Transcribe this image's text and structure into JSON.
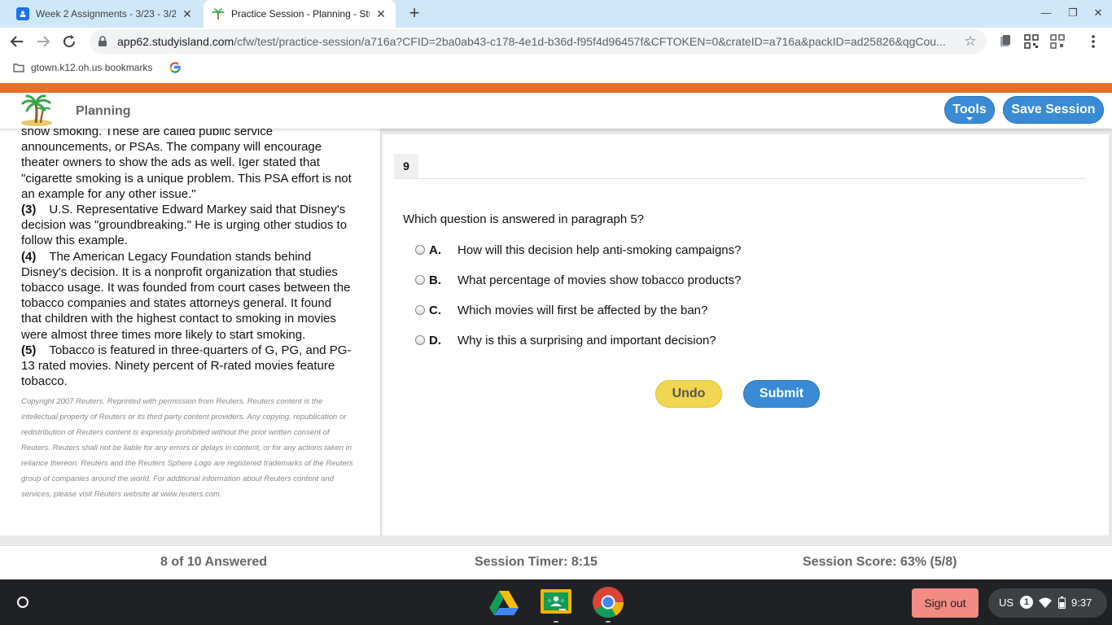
{
  "browser": {
    "tabs": [
      {
        "title": "Week 2 Assignments - 3/23 - 3/2",
        "icon": "classroom-favicon-icon"
      },
      {
        "title": "Practice Session - Planning - Stu",
        "icon": "studyisland-favicon-icon"
      }
    ],
    "url_host": "app62.studyisland.com",
    "url_path": "/cfw/test/practice-session/a716a?CFID=2ba0ab43-c178-4e1d-b36d-f95f4d96457f&CFTOKEN=0&crateID=a716a&packID=ad25826&qgCou...",
    "bookmarks": [
      {
        "label": "gtown.k12.oh.us bookmarks",
        "icon": "folder-icon"
      },
      {
        "label": "",
        "icon": "google-icon"
      }
    ]
  },
  "app": {
    "section_title": "Planning",
    "tools_label": "Tools",
    "save_label": "Save Session",
    "brand_color": "#e5702a",
    "button_color": "#3a8bd6"
  },
  "passage": {
    "top_fragment": "show smoking. These are called public service announcements, or PSAs. The company will encourage theater owners to show the ads as well. Iger stated that \"cigarette smoking is a unique problem. This PSA effort is not an example for any other issue.\"",
    "paragraphs": [
      {
        "num": "(3)",
        "text": "U.S. Representative Edward Markey said that Disney's decision was \"groundbreaking.\" He is urging other studios to follow this example."
      },
      {
        "num": "(4)",
        "text": "The American Legacy Foundation stands behind Disney's decision. It is a nonprofit organization that studies tobacco usage. It was founded from court cases between the tobacco companies and states attorneys general. It found that children with the highest contact to smoking in movies were almost three times more likely to start smoking."
      },
      {
        "num": "(5)",
        "text": "Tobacco is featured in three-quarters of G, PG, and PG-13 rated movies. Ninety percent of R-rated movies feature tobacco."
      }
    ],
    "copyright": "Copyright 2007 Reuters. Reprinted with permission from Reuters. Reuters content is the intellectual property of Reuters or its third party content providers. Any copying, republication or redistribution of Reuters content is expressly prohibited without the prior written consent of Reuters. Reuters shall not be liable for any errors or delays in content, or for any actions taken in reliance thereon. Reuters and the Reuters Sphere Logo are registered trademarks of the Reuters group of companies around the world. For additional information about Reuters content and services, please visit Reuters website at www.reuters.com."
  },
  "question": {
    "number": "9",
    "text": "Which question is answered in paragraph 5?",
    "choices": [
      {
        "letter": "A.",
        "text": "How will this decision help anti-smoking campaigns?"
      },
      {
        "letter": "B.",
        "text": "What percentage of movies show tobacco products?"
      },
      {
        "letter": "C.",
        "text": "Which movies will first be affected by the ban?"
      },
      {
        "letter": "D.",
        "text": "Why is this a surprising and important decision?"
      }
    ],
    "undo_label": "Undo",
    "submit_label": "Submit"
  },
  "status": {
    "answered": "8 of 10 Answered",
    "timer": "Session Timer: 8:15",
    "score": "Session Score: 63% (5/8)"
  },
  "shelf": {
    "apps": [
      "google-drive-icon",
      "google-classroom-icon",
      "chrome-icon"
    ],
    "signout_label": "Sign out",
    "locale": "US",
    "notification_count": "1",
    "time": "9:37"
  }
}
